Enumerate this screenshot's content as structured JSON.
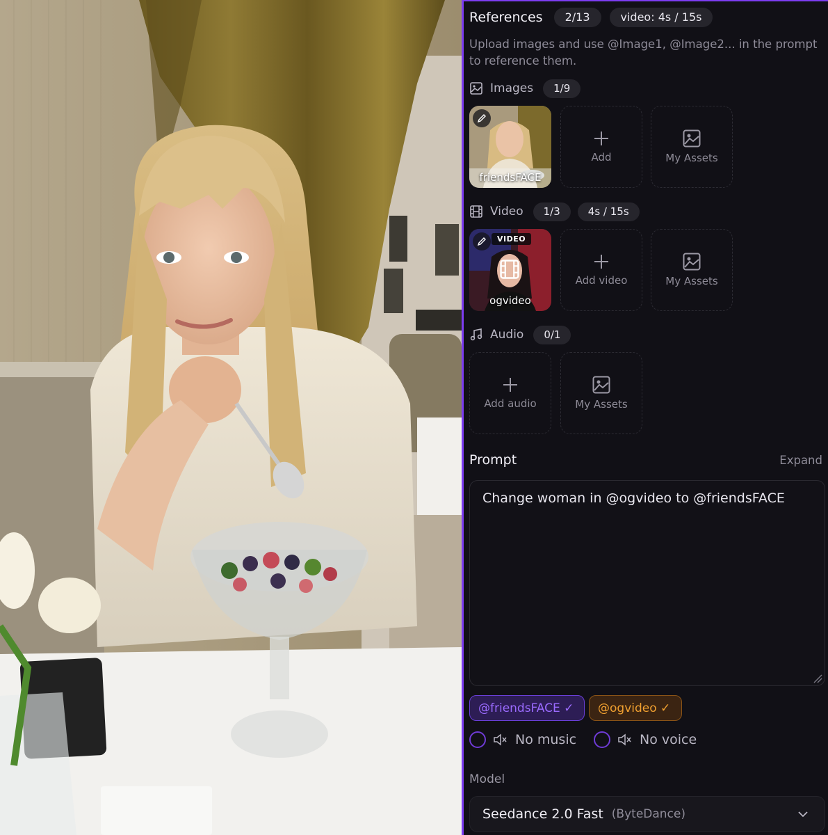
{
  "references": {
    "title": "References",
    "count": "2/13",
    "video_limit": "video: 4s / 15s",
    "description": "Upload images and use @Image1, @Image2... in the prompt to reference them."
  },
  "images": {
    "label": "Images",
    "count": "1/9",
    "items": [
      {
        "name": "friendsFACE"
      }
    ],
    "add_label": "Add",
    "assets_label": "My Assets"
  },
  "video": {
    "label": "Video",
    "count": "1/3",
    "duration": "4s / 15s",
    "items": [
      {
        "name": "ogvideo",
        "badge": "VIDEO"
      }
    ],
    "add_label": "Add video",
    "assets_label": "My Assets"
  },
  "audio": {
    "label": "Audio",
    "count": "0/1",
    "add_label": "Add audio",
    "assets_label": "My Assets"
  },
  "prompt": {
    "title": "Prompt",
    "expand_label": "Expand",
    "text": "Change woman in @ogvideo to @friendsFACE"
  },
  "mentions": [
    {
      "label": "@friendsFACE ✓",
      "color": "#9b6bff"
    },
    {
      "label": "@ogvideo ✓",
      "color": "#f0a030"
    }
  ],
  "options": {
    "no_music": {
      "label": "No music",
      "checked": false
    },
    "no_voice": {
      "label": "No voice",
      "checked": false
    }
  },
  "model": {
    "label": "Model",
    "name": "Seedance 2.0 Fast",
    "vendor": "(ByteDance)"
  },
  "colors": {
    "accent": "#7c3cf0",
    "panel_bg": "#111016"
  },
  "icons": [
    "image-icon",
    "film-icon",
    "music-icon",
    "plus-icon",
    "pencil-icon",
    "mute-icon",
    "chevron-down-icon",
    "resize-handle-icon"
  ]
}
